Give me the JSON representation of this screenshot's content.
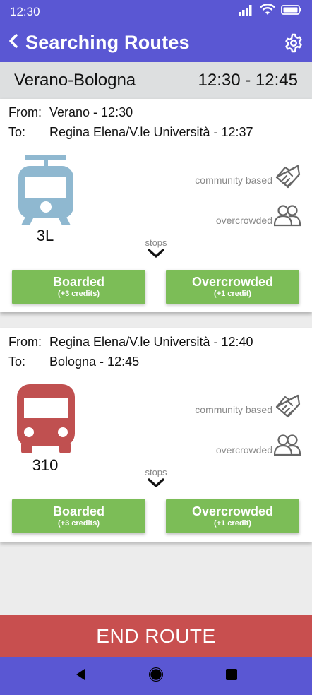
{
  "status_bar": {
    "time": "12:30",
    "icons": [
      "signal-icon",
      "wifi-icon",
      "battery-icon"
    ]
  },
  "app_bar": {
    "title": "Searching Routes",
    "back_icon": "chevron-left-icon",
    "settings_icon": "gear-icon"
  },
  "route_header": {
    "route": "Verano-Bologna",
    "time_range": "12:30 - 12:45"
  },
  "legs": [
    {
      "from_label": "From:",
      "from": "Verano - 12:30",
      "to_label": "To:",
      "to": "Regina Elena/V.le Università - 12:37",
      "vehicle": "tram-icon",
      "vehicle_color": "#8fb8d0",
      "line": "3L",
      "tag_community": "community based",
      "tag_crowd": "overcrowded",
      "stops_label": "stops",
      "boarded_label": "Boarded",
      "boarded_credits": "(+3 credits)",
      "overcrowded_label": "Overcrowded",
      "overcrowded_credits": "(+1 credit)"
    },
    {
      "from_label": "From:",
      "from": "Regina Elena/V.le Università - 12:40",
      "to_label": "To:",
      "to": "Bologna - 12:45",
      "vehicle": "bus-icon",
      "vehicle_color": "#c05050",
      "line": "310",
      "tag_community": "community based",
      "tag_crowd": "overcrowded",
      "stops_label": "stops",
      "boarded_label": "Boarded",
      "boarded_credits": "(+3 credits)",
      "overcrowded_label": "Overcrowded",
      "overcrowded_credits": "(+1 credit)"
    }
  ],
  "end_route_label": "END ROUTE",
  "colors": {
    "primary": "#5a57d3",
    "accent_green": "#7cbd57",
    "end_red": "#c84f4f"
  },
  "nav_bar": {
    "buttons": [
      "back-triangle-icon",
      "home-circle-icon",
      "recents-square-icon"
    ]
  }
}
